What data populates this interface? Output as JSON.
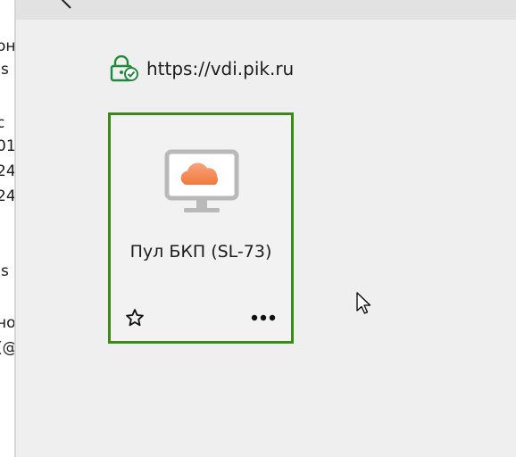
{
  "left_panel": {
    "fragments": [
      "он",
      "Js",
      "с",
      "01",
      "24",
      "24",
      "Js",
      "но",
      "(@"
    ]
  },
  "address": {
    "url": "https://vdi.pik.ru"
  },
  "tile": {
    "title": "Пул БКП (SL-73)",
    "border_color": "#3a8a18"
  },
  "icons": {
    "back": "back-arrow-icon",
    "lock": "secure-lock-icon",
    "monitor": "cloud-desktop-icon",
    "favorite": "star-icon",
    "more": "more-options-icon",
    "cursor": "mouse-cursor-icon"
  }
}
